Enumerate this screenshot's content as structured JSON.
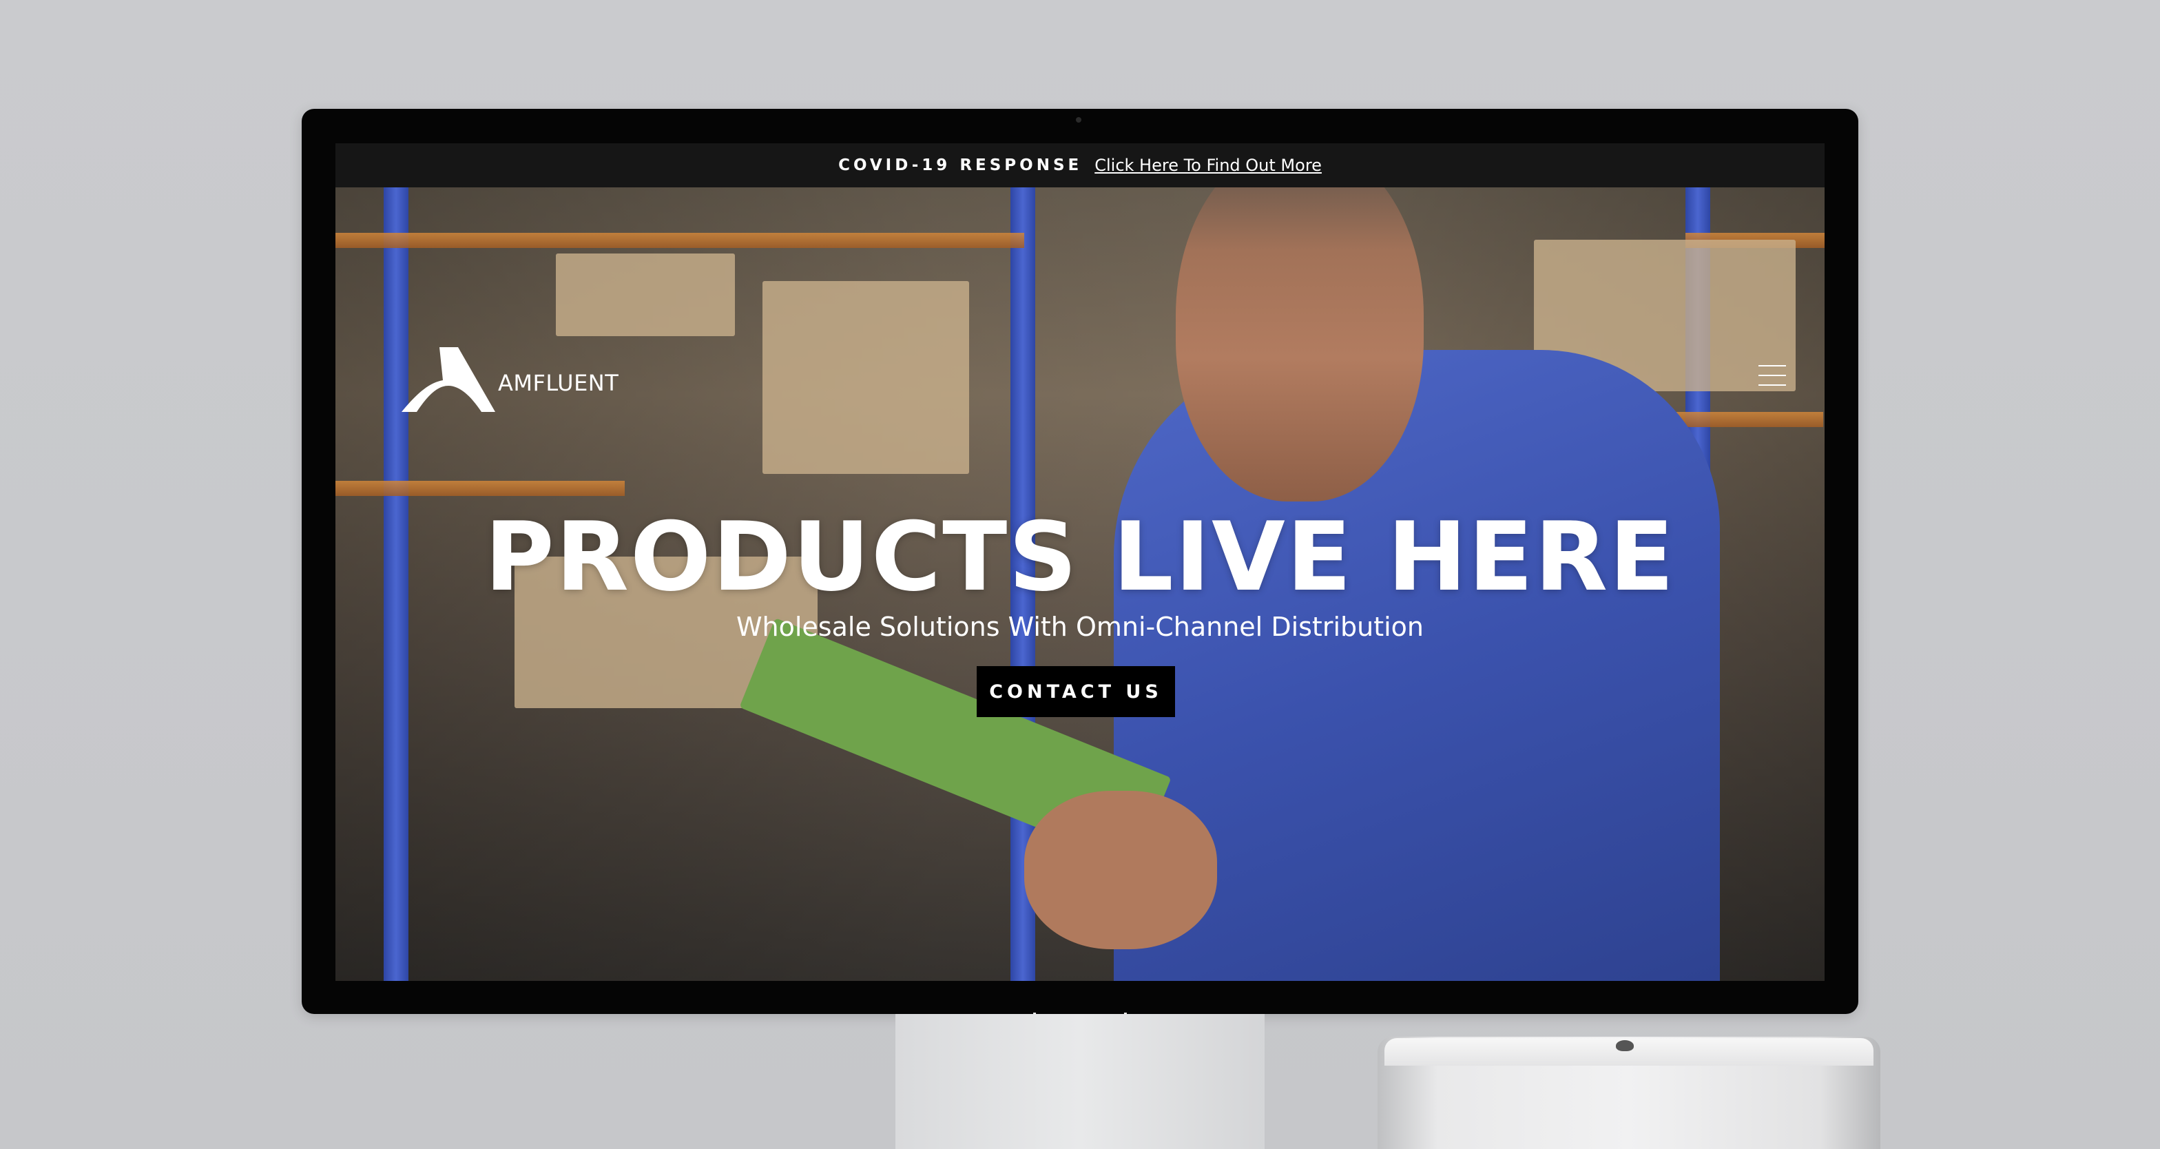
{
  "banner": {
    "label": "COVID-19 RESPONSE",
    "link_text": "Click Here To Find Out More"
  },
  "header": {
    "logo_text": "AMFLUENT",
    "logo_icon": "amfluent-a-logo",
    "menu_icon": "hamburger-menu-icon"
  },
  "hero": {
    "title": "PRODUCTS LIVE HERE",
    "subtitle": "Wholesale Solutions With Omni-Channel Distribution",
    "cta_label": "CONTACT US"
  },
  "colors": {
    "banner_bg": "#161616",
    "cta_bg": "#000000",
    "text": "#ffffff",
    "shirt_blue": "#3b52ad",
    "shelf_blue": "#2e46a5",
    "shelf_orange": "#d2873a"
  }
}
